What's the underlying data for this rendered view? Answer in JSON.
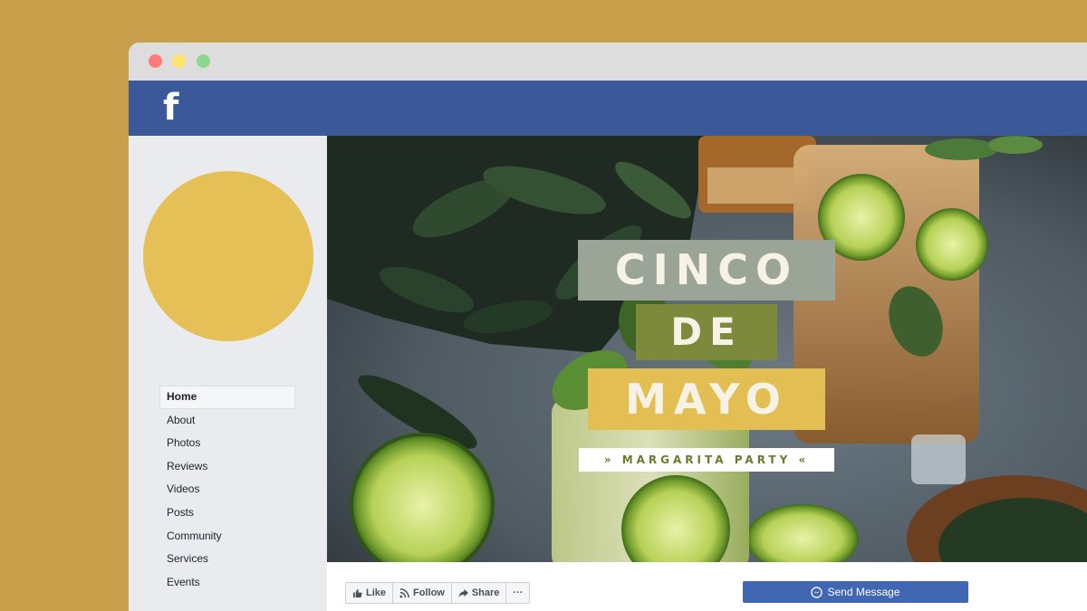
{
  "window": {
    "controls": [
      "close",
      "minimize",
      "maximize"
    ]
  },
  "header": {
    "logo": "f",
    "logo_icon": "facebook-logo-icon"
  },
  "sidebar": {
    "items": [
      {
        "label": "Home",
        "active": true
      },
      {
        "label": "About"
      },
      {
        "label": "Photos"
      },
      {
        "label": "Reviews"
      },
      {
        "label": "Videos"
      },
      {
        "label": "Posts"
      },
      {
        "label": "Community"
      },
      {
        "label": "Services"
      },
      {
        "label": "Events"
      }
    ]
  },
  "cover": {
    "line1": "CINCO",
    "line2": "DE",
    "line3": "MAYO",
    "tagline": "» MARGARITA PARTY «"
  },
  "actions": {
    "like": "Like",
    "follow": "Follow",
    "share": "Share",
    "more": "···",
    "send_message": "Send Message"
  },
  "colors": {
    "page_bg": "#c99f4c",
    "fb_blue": "#3b5998",
    "avatar": "#e5c056",
    "sage": "#9aa597",
    "olive": "#7d8a3c",
    "mustard": "#e2be53",
    "button_blue": "#4267b2"
  }
}
